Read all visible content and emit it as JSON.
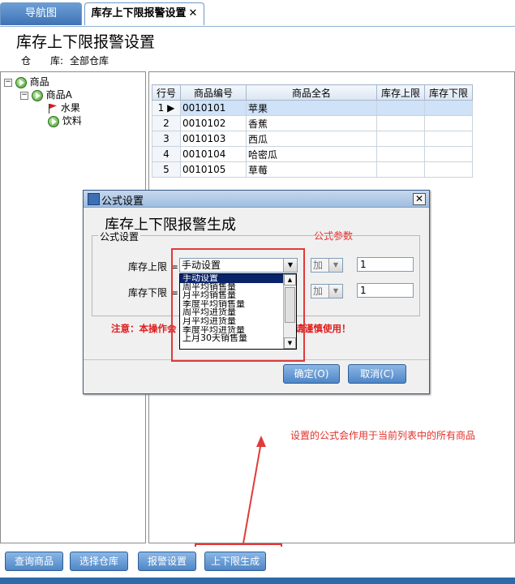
{
  "tabs": {
    "nav_label": "导航图",
    "active_label": "库存上下限报警设置",
    "close_glyph": "✕"
  },
  "page": {
    "title": "库存上下限报警设置",
    "warehouse_label": "仓　　库:",
    "warehouse_value": "全部仓库"
  },
  "tree": {
    "root": "商品",
    "group": "商品A",
    "children": [
      "水果",
      "饮料"
    ],
    "expand_glyph": "⊟"
  },
  "grid": {
    "columns": [
      "行号",
      "商品编号",
      "商品全名",
      "库存上限",
      "库存下限"
    ],
    "rows": [
      {
        "row": "1",
        "code": "0010101",
        "name": "苹果",
        "upper": "",
        "lower": ""
      },
      {
        "row": "2",
        "code": "0010102",
        "name": "香蕉",
        "upper": "",
        "lower": ""
      },
      {
        "row": "3",
        "code": "0010103",
        "name": "西瓜",
        "upper": "",
        "lower": ""
      },
      {
        "row": "4",
        "code": "0010104",
        "name": "哈密瓜",
        "upper": "",
        "lower": ""
      },
      {
        "row": "5",
        "code": "0010105",
        "name": "草莓",
        "upper": "",
        "lower": ""
      }
    ],
    "selected_row_marker": "▶"
  },
  "dialog": {
    "title": "公式设置",
    "close_glyph": "✕",
    "heading": "库存上下限报警生成",
    "param_label": "公式参数",
    "group_title": "公式设置",
    "upper_label": "库存上限 =",
    "upper_combo_value": "手动设置",
    "upper_op": "加",
    "upper_value": "1",
    "lower_label": "库存下限 =",
    "lower_op": "加",
    "lower_value": "1",
    "notice": "注意：本操作会",
    "notice_tail": "有商品，请谨慎使用！",
    "options": [
      "手动设置",
      "周平均销售量",
      "月平均销售量",
      "季度平均销售量",
      "周平均进货量",
      "月平均进货量",
      "季度平均进货量",
      "上月30天销售量"
    ],
    "ok_label": "确定(O)",
    "cancel_label": "取消(C)"
  },
  "annotation": {
    "text": "设置的公式会作用于当前列表中的所有商品"
  },
  "toolbar": {
    "query_label": "查询商品",
    "warehouse_label": "选择仓库",
    "alarm_label": "报警设置",
    "generate_label": "上下限生成"
  },
  "colors": {
    "accent_blue": "#4f86c6",
    "annotation_red": "#e0312b",
    "selection": "#cfe2f7"
  }
}
